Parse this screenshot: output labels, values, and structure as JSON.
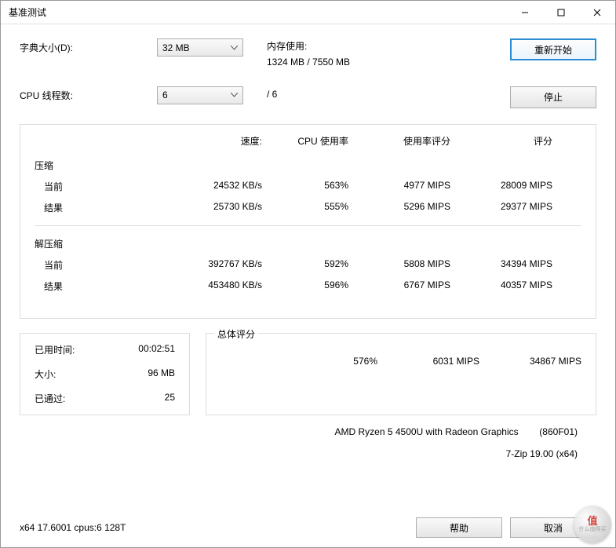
{
  "window": {
    "title": "基准测试"
  },
  "controls": {
    "dict_label": "字典大小(D):",
    "dict_value": "32 MB",
    "threads_label": "CPU 线程数:",
    "threads_value": "6",
    "threads_total": "/ 6",
    "mem_label": "内存使用:",
    "mem_value": "1324 MB / 7550 MB"
  },
  "buttons": {
    "restart": "重新开始",
    "stop": "停止",
    "help": "帮助",
    "cancel": "取消"
  },
  "headers": {
    "speed": "速度:",
    "cpu_usage": "CPU 使用率",
    "usage_rating": "使用率评分",
    "rating": "评分"
  },
  "sections": {
    "compress": "压缩",
    "decompress": "解压缩",
    "current": "当前",
    "result": "结果",
    "overall": "总体评分"
  },
  "compress": {
    "current": {
      "speed": "24532 KB/s",
      "cpu": "563%",
      "usage_rating": "4977 MIPS",
      "rating": "28009 MIPS"
    },
    "result": {
      "speed": "25730 KB/s",
      "cpu": "555%",
      "usage_rating": "5296 MIPS",
      "rating": "29377 MIPS"
    }
  },
  "decompress": {
    "current": {
      "speed": "392767 KB/s",
      "cpu": "592%",
      "usage_rating": "5808 MIPS",
      "rating": "34394 MIPS"
    },
    "result": {
      "speed": "453480 KB/s",
      "cpu": "596%",
      "usage_rating": "6767 MIPS",
      "rating": "40357 MIPS"
    }
  },
  "stats": {
    "elapsed_label": "已用时间:",
    "elapsed_value": "00:02:51",
    "size_label": "大小:",
    "size_value": "96 MB",
    "passed_label": "已通过:",
    "passed_value": "25"
  },
  "overall": {
    "cpu": "576%",
    "usage_rating": "6031 MIPS",
    "rating": "34867 MIPS"
  },
  "cpu_info": {
    "name": "AMD Ryzen 5 4500U with Radeon Graphics",
    "id": "(860F01)"
  },
  "app_info": "7-Zip 19.00 (x64)",
  "status": "x64 17.6001 cpus:6 128T",
  "watermark": {
    "top": "值",
    "bottom": "什么值得买"
  }
}
